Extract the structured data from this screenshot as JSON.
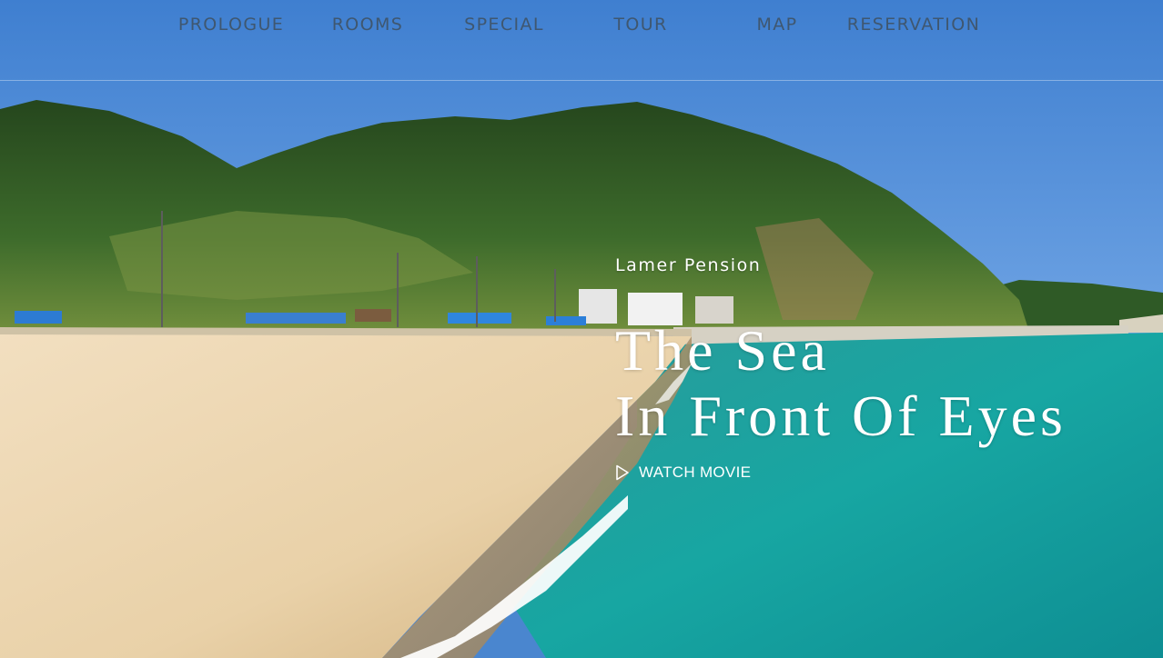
{
  "nav": {
    "items": [
      {
        "label": "PROLOGUE"
      },
      {
        "label": "ROOMS"
      },
      {
        "label": "SPECIAL"
      },
      {
        "label": "TOUR"
      },
      {
        "label": "MAP"
      },
      {
        "label": "RESERVATION"
      }
    ]
  },
  "hero": {
    "eyebrow": "Lamer Pension",
    "headline_line1": "The Sea",
    "headline_line2": "In Front Of Eyes",
    "watch_label": "WATCH MOVIE",
    "watch_icon": "play-icon"
  },
  "background": {
    "scene": "beach-hero-image",
    "colors": {
      "sky": "#4a86cf",
      "hill": "#3d6a2a",
      "sand": "#ecd6b2",
      "sea": "#1aa3a0",
      "foam": "#ffffff",
      "nav_text": "#3f5770"
    }
  }
}
